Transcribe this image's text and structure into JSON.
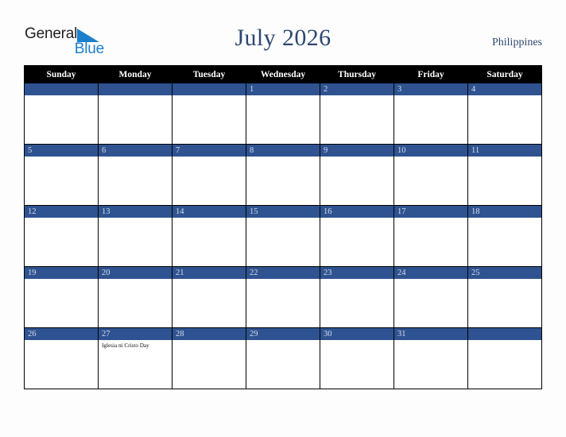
{
  "logo": {
    "word_one": "General",
    "word_two": "Blue",
    "triangle_icon": "triangle-icon",
    "blue_hex": "#1b7fcc",
    "dark_hex": "#1f1f1f"
  },
  "header": {
    "title": "July 2026",
    "country": "Philippines",
    "title_color": "#2c4670"
  },
  "calendar": {
    "month": "July",
    "year": "2026",
    "header_bg": "#000000",
    "daybar_bg": "#2f5391",
    "weekdays": [
      "Sunday",
      "Monday",
      "Tuesday",
      "Wednesday",
      "Thursday",
      "Friday",
      "Saturday"
    ],
    "weeks": [
      [
        {
          "day": "",
          "events": []
        },
        {
          "day": "",
          "events": []
        },
        {
          "day": "",
          "events": []
        },
        {
          "day": "1",
          "events": []
        },
        {
          "day": "2",
          "events": []
        },
        {
          "day": "3",
          "events": []
        },
        {
          "day": "4",
          "events": []
        }
      ],
      [
        {
          "day": "5",
          "events": []
        },
        {
          "day": "6",
          "events": []
        },
        {
          "day": "7",
          "events": []
        },
        {
          "day": "8",
          "events": []
        },
        {
          "day": "9",
          "events": []
        },
        {
          "day": "10",
          "events": []
        },
        {
          "day": "11",
          "events": []
        }
      ],
      [
        {
          "day": "12",
          "events": []
        },
        {
          "day": "13",
          "events": []
        },
        {
          "day": "14",
          "events": []
        },
        {
          "day": "15",
          "events": []
        },
        {
          "day": "16",
          "events": []
        },
        {
          "day": "17",
          "events": []
        },
        {
          "day": "18",
          "events": []
        }
      ],
      [
        {
          "day": "19",
          "events": []
        },
        {
          "day": "20",
          "events": []
        },
        {
          "day": "21",
          "events": []
        },
        {
          "day": "22",
          "events": []
        },
        {
          "day": "23",
          "events": []
        },
        {
          "day": "24",
          "events": []
        },
        {
          "day": "25",
          "events": []
        }
      ],
      [
        {
          "day": "26",
          "events": []
        },
        {
          "day": "27",
          "events": [
            "Iglesia ni Cristo Day"
          ]
        },
        {
          "day": "28",
          "events": []
        },
        {
          "day": "29",
          "events": []
        },
        {
          "day": "30",
          "events": []
        },
        {
          "day": "31",
          "events": []
        },
        {
          "day": "",
          "events": []
        }
      ]
    ]
  }
}
